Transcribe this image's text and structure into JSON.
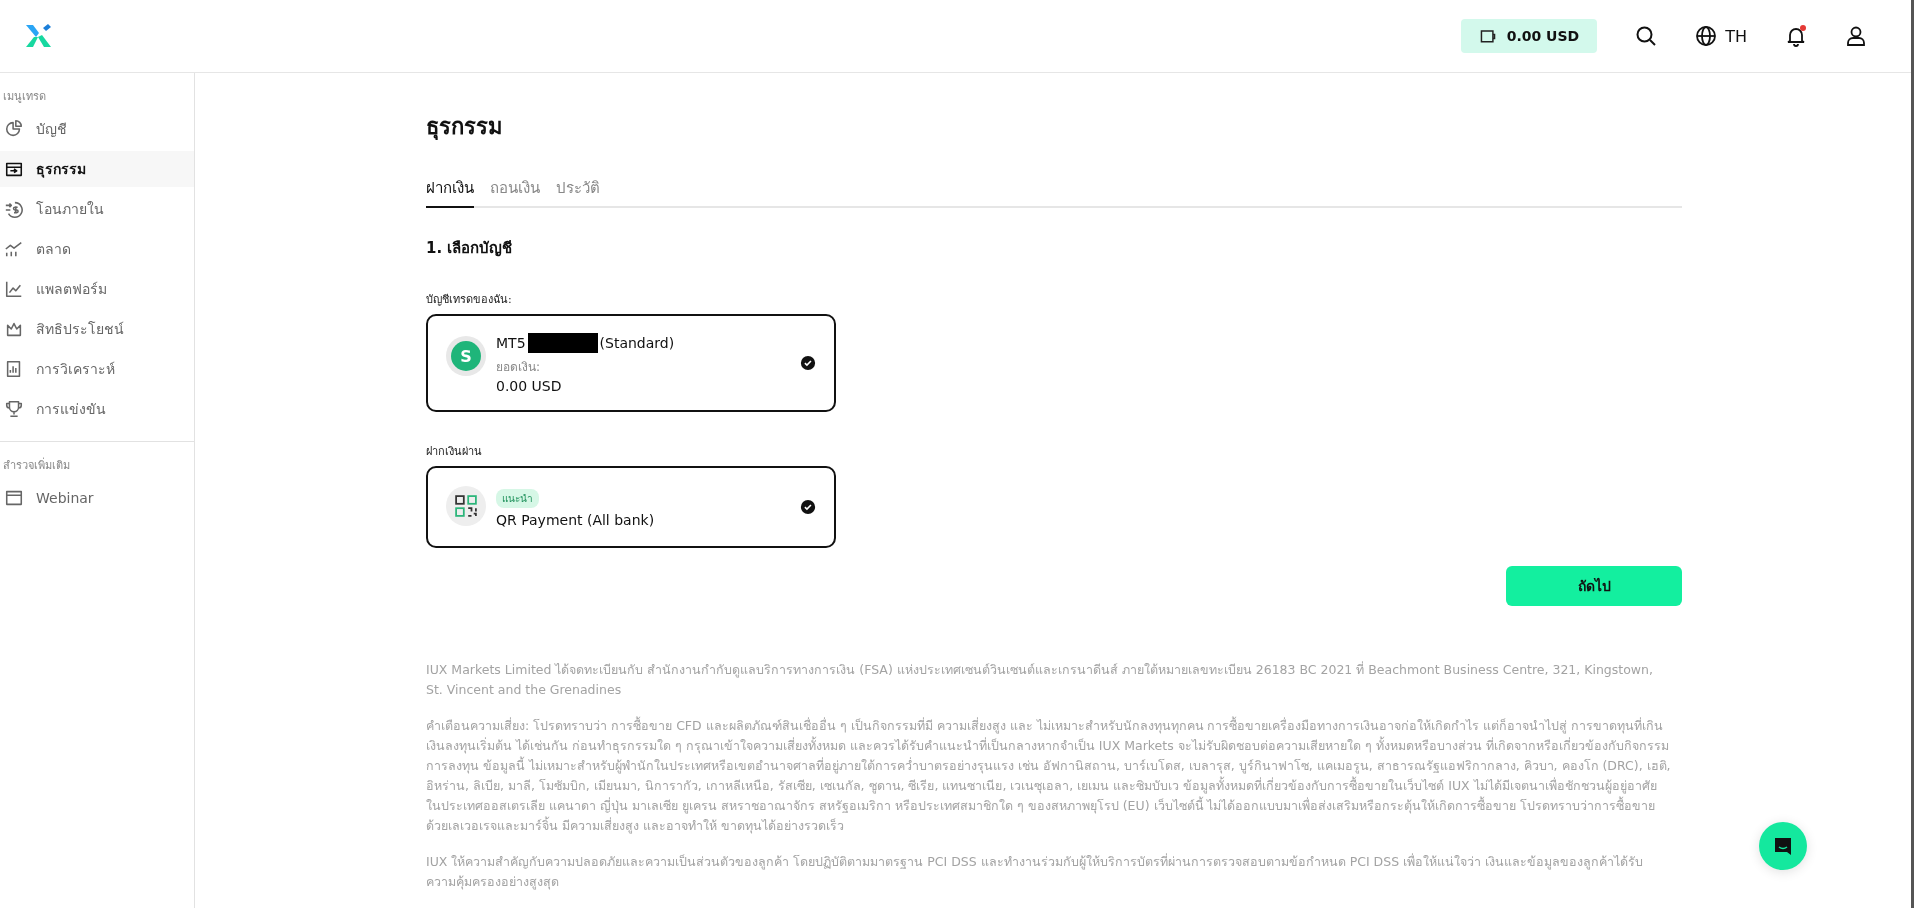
{
  "header": {
    "balance": "0.00 USD",
    "language": "TH",
    "notification_unread": true
  },
  "sidebar": {
    "sections": [
      {
        "title": "เมนูเทรด",
        "items": [
          {
            "label": "บัญชี",
            "selected": false
          },
          {
            "label": "ธุรกรรม",
            "selected": true
          },
          {
            "label": "โอนภายใน",
            "selected": false
          },
          {
            "label": "ตลาด",
            "selected": false
          },
          {
            "label": "แพลตฟอร์ม",
            "selected": false
          },
          {
            "label": "สิทธิประโยชน์",
            "selected": false
          },
          {
            "label": "การวิเคราะห์",
            "selected": false
          },
          {
            "label": "การแข่งขัน",
            "selected": false
          }
        ]
      },
      {
        "title": "สำรวจเพิ่มเติม",
        "items": [
          {
            "label": "Webinar",
            "selected": false
          }
        ]
      }
    ]
  },
  "page": {
    "title": "ธุรกรรม",
    "tabs": [
      {
        "label": "ฝากเงิน",
        "selected": true
      },
      {
        "label": "ถอนเงิน",
        "selected": false
      },
      {
        "label": "ประวัติ",
        "selected": false
      }
    ],
    "step": "1. เลือกบัญชี",
    "account_label": "บัญชีเทรดของฉัน:",
    "account": {
      "avatar": "S",
      "platform": "MT5",
      "number_redacted": true,
      "type": "(Standard)",
      "balance_label": "ยอดเงิน:",
      "balance": "0.00 USD",
      "selected": true
    },
    "method_label": "ฝากเงินผ่าน",
    "method": {
      "badge": "แนะนำ",
      "name": "QR Payment (All bank)",
      "selected": true
    },
    "next_button": "ถัดไป"
  },
  "footer": [
    "IUX Markets Limited ได้จดทะเบียนกับ สำนักงานกำกับดูแลบริการทางการเงิน (FSA) แห่งประเทศเซนต์วินเซนต์และเกรนาดีนส์ ภายใต้หมายเลขทะเบียน 26183 BC 2021 ที่ Beachmont Business Centre, 321, Kingstown, St. Vincent and the Grenadines",
    "คำเตือนความเสี่ยง: โปรดทราบว่า การซื้อขาย CFD และผลิตภัณฑ์สินเชื่ออื่น ๆ เป็นกิจกรรมที่มี ความเสี่ยงสูง และ ไม่เหมาะสำหรับนักลงทุนทุกคน การซื้อขายเครื่องมือทางการเงินอาจก่อให้เกิดกำไร แต่ก็อาจนำไปสู่ การขาดทุนที่เกินเงินลงทุนเริ่มต้น ได้เช่นกัน ก่อนทำธุรกรรมใด ๆ กรุณาเข้าใจความเสี่ยงทั้งหมด และควรได้รับคำแนะนำที่เป็นกลางหากจำเป็น IUX Markets จะไม่รับผิดชอบต่อความเสียหายใด ๆ ทั้งหมดหรือบางส่วน ที่เกิดจากหรือเกี่ยวข้องกับกิจกรรมการลงทุน ข้อมูลนี้ ไม่เหมาะสำหรับผู้พำนักในประเทศหรือเขตอำนาจศาลที่อยู่ภายใต้การคว่ำบาตรอย่างรุนแรง เช่น อัฟกานิสถาน, บาร์เบโดส, เบลารุส, บูร์กินาฟาโซ, แคเมอรูน, สาธารณรัฐแอฟริกากลาง, คิวบา, คองโก (DRC), เฮติ, อิหร่าน, ลิเบีย, มาลี, โมซัมบิก, เมียนมา, นิการากัว, เกาหลีเหนือ, รัสเซีย, เซเนกัล, ซูดาน, ซีเรีย, แทนซาเนีย, เวเนซุเอลา, เยเมน และซิมบับเว ข้อมูลทั้งหมดที่เกี่ยวข้องกับการซื้อขายในเว็บไซต์ IUX ไม่ได้มีเจตนาเพื่อชักชวนผู้อยู่อาศัยในประเทศออสเตรเลีย แคนาดา ญี่ปุ่น มาเลเซีย ยูเครน สหราชอาณาจักร สหรัฐอเมริกา หรือประเทศสมาชิกใด ๆ ของสหภาพยุโรป (EU) เว็บไซต์นี้ ไม่ได้ออกแบบมาเพื่อส่งเสริมหรือกระตุ้นให้เกิดการซื้อขาย โปรดทราบว่าการซื้อขายด้วยเลเวอเรจและมาร์จิ้น มีความเสี่ยงสูง และอาจทำให้ ขาดทุนได้อย่างรวดเร็ว",
    "IUX ให้ความสำคัญกับความปลอดภัยและความเป็นส่วนตัวของลูกค้า โดยปฏิบัติตามมาตรฐาน PCI DSS และทำงานร่วมกับผู้ให้บริการบัตรที่ผ่านการตรวจสอบตามข้อกำหนด PCI DSS เพื่อให้แน่ใจว่า เงินและข้อมูลของลูกค้าได้รับความคุ้มครองอย่างสูงสุด"
  ]
}
